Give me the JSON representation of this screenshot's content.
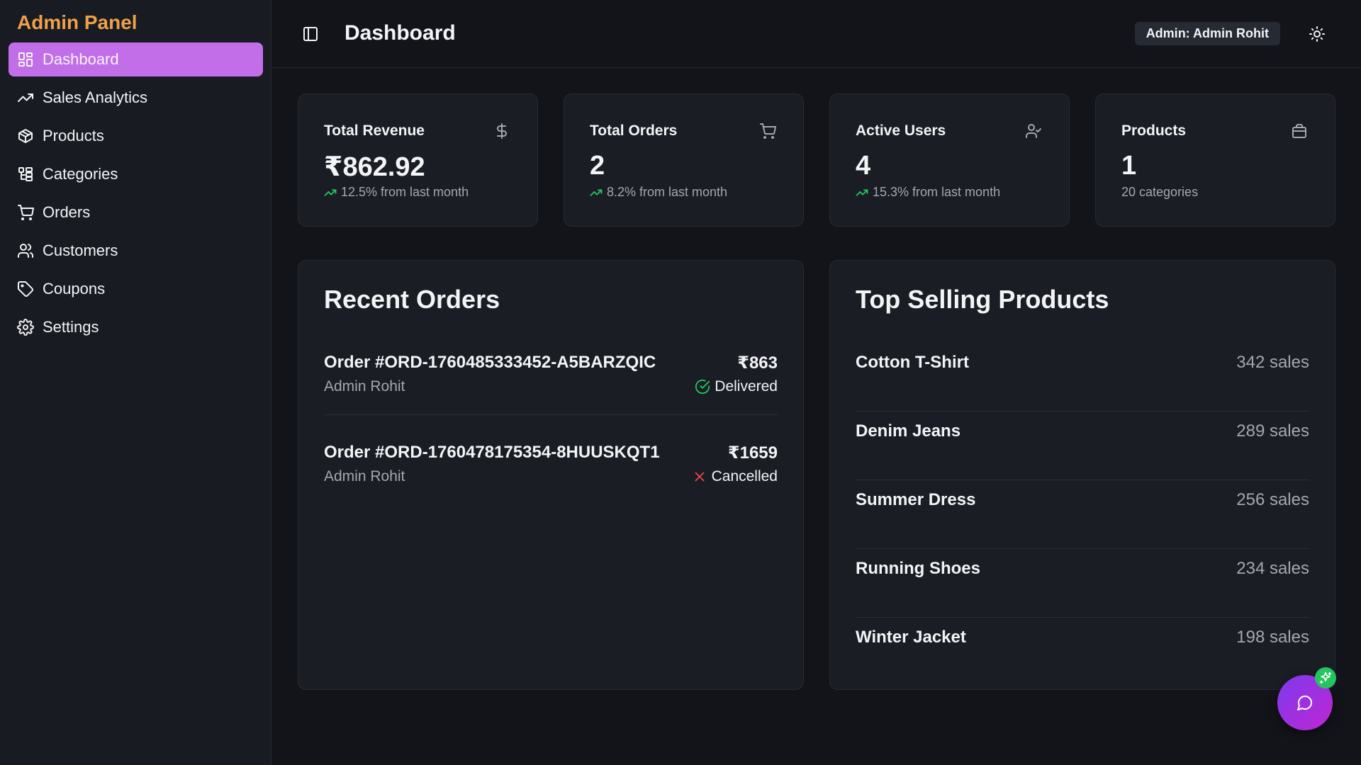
{
  "sidebar": {
    "brand": "Admin Panel",
    "brand_color": "#f0a04b",
    "active_color": "#c26ee8",
    "items": [
      {
        "label": "Dashboard",
        "icon": "dashboard-icon",
        "active": true
      },
      {
        "label": "Sales Analytics",
        "icon": "trending-up-icon"
      },
      {
        "label": "Products",
        "icon": "package-icon"
      },
      {
        "label": "Categories",
        "icon": "categories-icon"
      },
      {
        "label": "Orders",
        "icon": "cart-icon"
      },
      {
        "label": "Customers",
        "icon": "users-icon"
      },
      {
        "label": "Coupons",
        "icon": "tag-icon"
      },
      {
        "label": "Settings",
        "icon": "gear-icon"
      }
    ]
  },
  "header": {
    "title": "Dashboard",
    "admin_badge": "Admin: Admin Rohit",
    "sidebar_toggle_icon": "panel-left-icon",
    "theme_icon": "sun-icon"
  },
  "stats": [
    {
      "label": "Total Revenue",
      "value": "₹862.92",
      "sub": "12.5% from last month",
      "icon": "dollar-icon",
      "trend": true
    },
    {
      "label": "Total Orders",
      "value": "2",
      "sub": "8.2% from last month",
      "icon": "cart-icon",
      "trend": true
    },
    {
      "label": "Active Users",
      "value": "4",
      "sub": "15.3% from last month",
      "icon": "user-check-icon",
      "trend": true
    },
    {
      "label": "Products",
      "value": "1",
      "sub": "20 categories",
      "icon": "package-box-icon",
      "trend": false
    }
  ],
  "recent_orders": {
    "title": "Recent Orders",
    "orders": [
      {
        "id": "Order #ORD-1760485333452-A5BARZQIC",
        "customer": "Admin Rohit",
        "amount": "₹863",
        "status": "Delivered",
        "status_icon": "check-circle-icon",
        "status_color": "#22c55e"
      },
      {
        "id": "Order #ORD-1760478175354-8HUUSKQT1",
        "customer": "Admin Rohit",
        "amount": "₹1659",
        "status": "Cancelled",
        "status_icon": "x-icon",
        "status_color": "#ef4444"
      }
    ]
  },
  "top_products": {
    "title": "Top Selling Products",
    "products": [
      {
        "name": "Cotton T-Shirt",
        "sales": "342 sales"
      },
      {
        "name": "Denim Jeans",
        "sales": "289 sales"
      },
      {
        "name": "Summer Dress",
        "sales": "256 sales"
      },
      {
        "name": "Running Shoes",
        "sales": "234 sales"
      },
      {
        "name": "Winter Jacket",
        "sales": "198 sales"
      }
    ]
  },
  "chat_fab": {
    "icon": "chat-icon",
    "badge_icon": "sparkle-icon"
  }
}
